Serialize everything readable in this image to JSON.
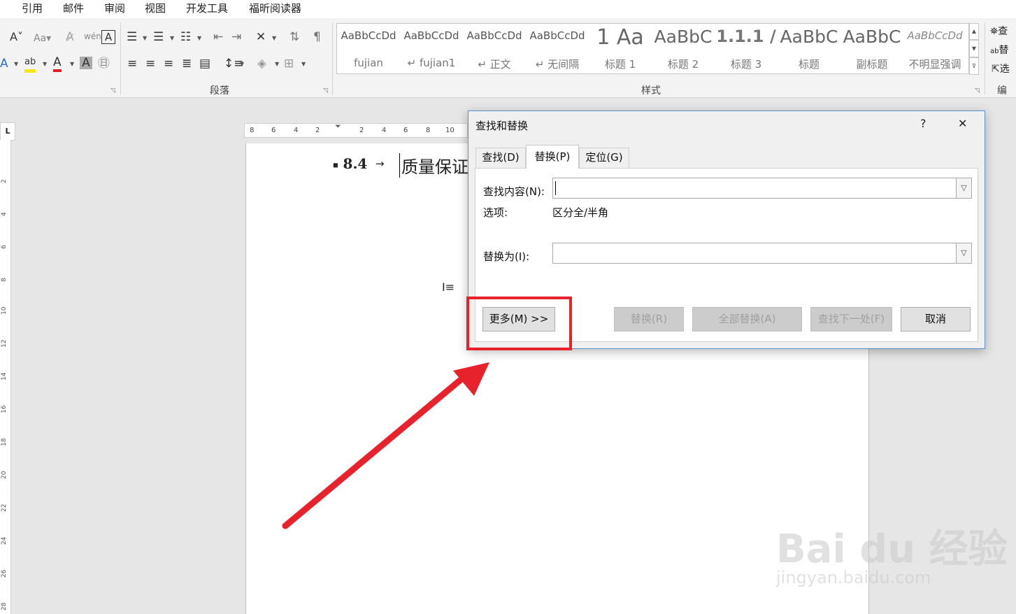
{
  "menu_tabs": [
    "引用",
    "邮件",
    "审阅",
    "视图",
    "开发工具",
    "福昕阅读器"
  ],
  "ribbon": {
    "groups": {
      "paragraph": "段落",
      "styles": "样式",
      "editing": "编"
    },
    "styles": [
      {
        "preview": "AaBbCcDd",
        "name": "fujian"
      },
      {
        "preview": "AaBbCcDd",
        "name": "↵ fujian1"
      },
      {
        "preview": "AaBbCcDd",
        "name": "↵ 正文"
      },
      {
        "preview": "AaBbCcDd",
        "name": "↵ 无间隔"
      },
      {
        "preview": "1  Aa",
        "name": "标题 1"
      },
      {
        "preview": "AaBbC",
        "name": "标题 2"
      },
      {
        "preview": "1.1.1  /",
        "name": "标题 3"
      },
      {
        "preview": "AaBbC",
        "name": "标题"
      },
      {
        "preview": "AaBbC",
        "name": "副标题"
      },
      {
        "preview": "AaBbCcDd",
        "name": "不明显强调"
      }
    ],
    "editing_tools": [
      "查",
      "替",
      "选"
    ]
  },
  "ruler": {
    "corner": "L",
    "horizontal": [
      "8",
      "6",
      "4",
      "2",
      "2",
      "4",
      "6",
      "8",
      "10"
    ],
    "vertical": [
      "2",
      "4",
      "6",
      "8",
      "10",
      "12",
      "14",
      "16",
      "18",
      "20",
      "22",
      "24",
      "26",
      "28"
    ]
  },
  "document": {
    "heading_number": "8.4",
    "tab_arrow": "→",
    "heading_text": "质量保证"
  },
  "dialog": {
    "title": "查找和替换",
    "help": "?",
    "close": "✕",
    "tabs": [
      "查找(D)",
      "替换(P)",
      "定位(G)"
    ],
    "active_tab": "替换(P)",
    "find_label": "查找内容(N):",
    "find_value": "",
    "options_label": "选项:",
    "options_value": "区分全/半角",
    "replace_label": "替换为(I):",
    "replace_value": "",
    "buttons": {
      "more": "更多(M) >>",
      "replace": "替换(R)",
      "replace_all": "全部替换(A)",
      "find_next": "查找下一处(F)",
      "cancel": "取消"
    }
  },
  "annotation": {
    "color": "#e8222c"
  },
  "watermark": {
    "brand": "Bai  du 经验",
    "url": "jingyan.baidu.com"
  }
}
